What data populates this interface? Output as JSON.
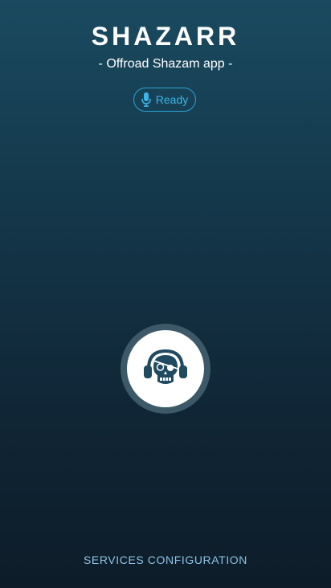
{
  "header": {
    "title": "SHAZARR",
    "subtitle": "- Offroad Shazam app -"
  },
  "status": {
    "icon": "microphone-icon",
    "label": "Ready",
    "color": "#3ab5e8"
  },
  "record_button": {
    "icon": "pirate-skull-headphones-icon",
    "icon_color": "#1f4a5f"
  },
  "footer": {
    "services_label": "SERVICES CONFIGURATION"
  },
  "colors": {
    "background_top": "#1a4a60",
    "background_bottom": "#0d1c28",
    "accent": "#2aa3d6",
    "link": "#8cc3e6"
  }
}
